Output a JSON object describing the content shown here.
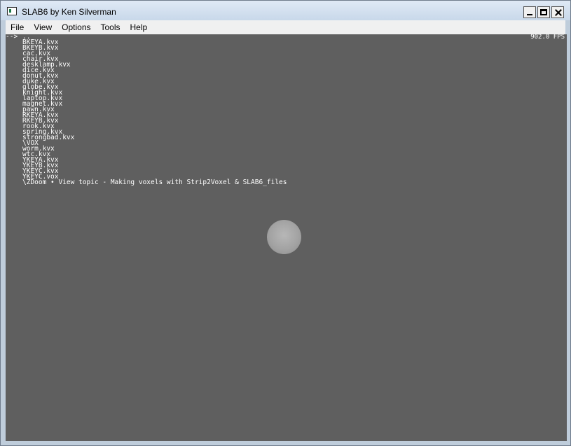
{
  "window": {
    "title": "SLAB6 by Ken Silverman"
  },
  "menubar": {
    "items": [
      "File",
      "View",
      "Options",
      "Tools",
      "Help"
    ]
  },
  "viewport": {
    "fps": "902.0 FPS",
    "cursor": "-->",
    "files": [
      "..",
      "BKEYA.kvx",
      "BKEYB.kvx",
      "cac.kvx",
      "chair.kvx",
      "desklamp.kvx",
      "dice.kvx",
      "donut.kvx",
      "duke.kvx",
      "globe.kvx",
      "knight.kvx",
      "laptop.kvx",
      "magnet.kvx",
      "pawn.kvx",
      "RKEYA.kvx",
      "RKEYB.kvx",
      "rook.kvx",
      "spring.kvx",
      "strongbad.kvx",
      "\\VOX",
      "worm.kvx",
      "wtc.kvx",
      "YKEYA.kvx",
      "YKEYB.kvx",
      "YKEYC.kvx",
      "YKEYC.vox",
      "\\ZDoom • View topic - Making voxels with Strip2Voxel & SLAB6_files"
    ],
    "colors": {
      "background": "#5f5f5f",
      "text": "#ffffff"
    }
  }
}
